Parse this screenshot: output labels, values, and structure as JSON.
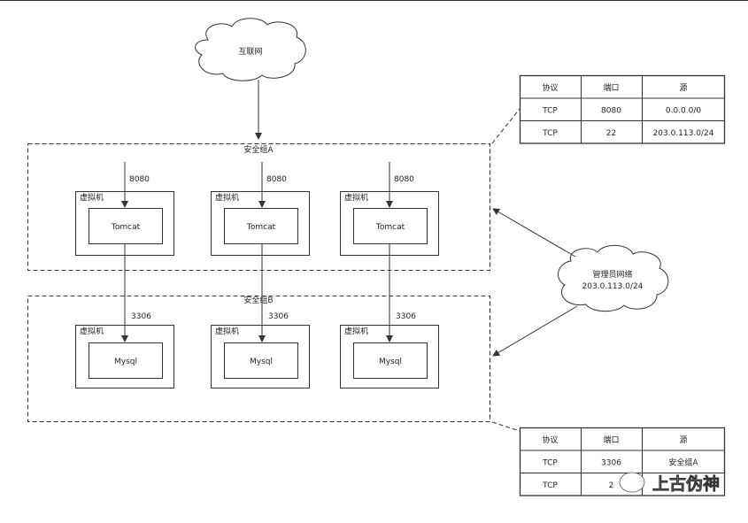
{
  "internet": {
    "label": "互联网"
  },
  "group_a": {
    "label": "安全组A",
    "port": "8080",
    "vms": [
      {
        "label": "虚拟机",
        "app": "Tomcat"
      },
      {
        "label": "虚拟机",
        "app": "Tomcat"
      },
      {
        "label": "虚拟机",
        "app": "Tomcat"
      }
    ]
  },
  "group_b": {
    "label": "安全组B",
    "port": "3306",
    "vms": [
      {
        "label": "虚拟机",
        "app": "Mysql"
      },
      {
        "label": "虚拟机",
        "app": "Mysql"
      },
      {
        "label": "虚拟机",
        "app": "Mysql"
      }
    ]
  },
  "admin": {
    "label": "管理员网络",
    "cidr": "203.0.113.0/24"
  },
  "table_a": {
    "headers": [
      "协议",
      "端口",
      "源"
    ],
    "rows": [
      [
        "TCP",
        "8080",
        "0.0.0.0/0"
      ],
      [
        "TCP",
        "22",
        "203.0.113.0/24"
      ]
    ]
  },
  "table_b": {
    "headers": [
      "协议",
      "端口",
      "源"
    ],
    "rows": [
      [
        "TCP",
        "3306",
        "安全组A"
      ],
      [
        "TCP",
        "2",
        ""
      ]
    ]
  },
  "watermark": "上古伪神"
}
